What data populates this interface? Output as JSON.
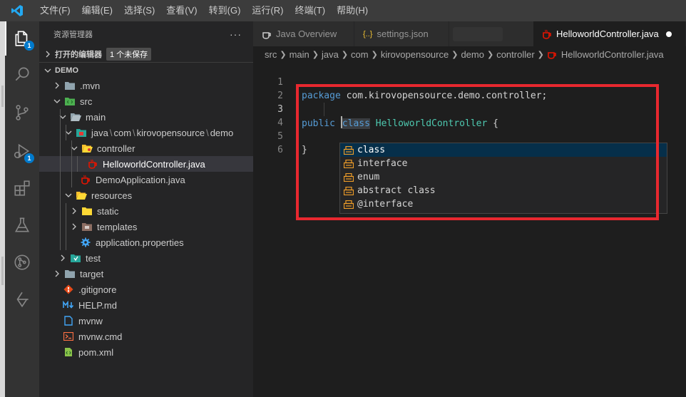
{
  "menu": [
    "文件(F)",
    "编辑(E)",
    "选择(S)",
    "查看(V)",
    "转到(G)",
    "运行(R)",
    "终端(T)",
    "帮助(H)"
  ],
  "activity": {
    "explorer_badge": "1",
    "debug_badge": "1"
  },
  "sidebar": {
    "title": "资源管理器",
    "more": "···",
    "open_editors": {
      "label": "打开的编辑器",
      "badge": "1 个未保存"
    },
    "project": "DEMO",
    "tree": {
      "mvn": ".mvn",
      "src": "src",
      "main": "main",
      "java_path": [
        "java",
        "com",
        "kirovopensource",
        "demo"
      ],
      "controller": "controller",
      "hello_controller": "HelloworldController.java",
      "demo_app": "DemoApplication.java",
      "resources": "resources",
      "static": "static",
      "templates": "templates",
      "app_props": "application.properties",
      "test": "test",
      "target": "target",
      "gitignore": ".gitignore",
      "help": "HELP.md",
      "mvnw": "mvnw",
      "mvnw_cmd": "mvnw.cmd",
      "pom": "pom.xml"
    }
  },
  "tabs": [
    {
      "label": "Java Overview"
    },
    {
      "label": "settings.json",
      "icon_text": "{..}"
    },
    {
      "label": "HelloworldController.java"
    }
  ],
  "breadcrumb": [
    "src",
    "main",
    "java",
    "com",
    "kirovopensource",
    "demo",
    "controller",
    "HelloworldController.java"
  ],
  "code": {
    "line_numbers": [
      "1",
      "2",
      "3",
      "4",
      "5",
      "6"
    ],
    "line1": {
      "kw": "package",
      "rest": " com.kirovopensource.demo.controller;"
    },
    "line3": {
      "kw1": "public",
      "kw2": "class",
      "type": "HelloworldController",
      "brace": " {"
    },
    "line5": "}"
  },
  "suggestions": [
    "class",
    "interface",
    "enum",
    "abstract class",
    "@interface"
  ],
  "colors": {
    "accent": "#007acc",
    "highlight_box": "#e8282f",
    "java_icon": "#e51400"
  }
}
